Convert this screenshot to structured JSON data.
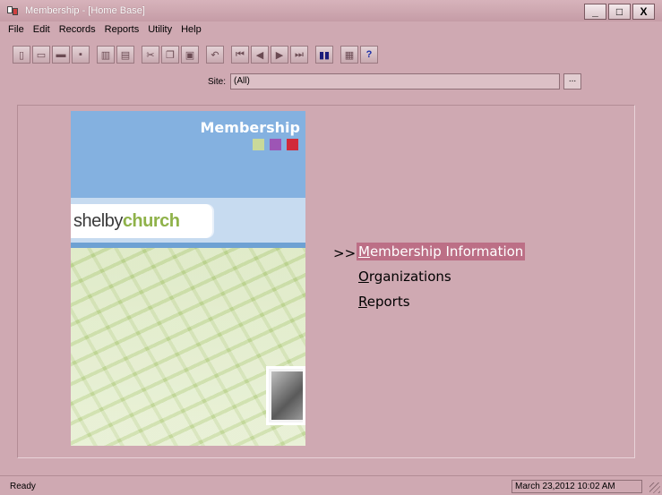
{
  "window": {
    "title": "Membership - [Home Base]",
    "controls": {
      "minimize": "_",
      "maximize": "□",
      "close": "X"
    }
  },
  "menubar": [
    "File",
    "Edit",
    "Records",
    "Reports",
    "Utility",
    "Help"
  ],
  "toolbar": {
    "icons": [
      "new-icon",
      "open-icon",
      "open-folder-icon",
      "save-icon",
      "delete-icon",
      "print-icon",
      "cut-icon",
      "copy-icon",
      "paste-icon",
      "undo-icon",
      "first-record-icon",
      "previous-record-icon",
      "next-record-icon",
      "last-record-icon",
      "chart-icon",
      "calculator-icon",
      "help-icon"
    ],
    "help_label": "?"
  },
  "site": {
    "label": "Site:",
    "value": "(All)",
    "button": "..."
  },
  "artwork": {
    "title": "Membership",
    "logo_part1": "shelby",
    "logo_part2": "church"
  },
  "nav": {
    "arrows": ">>",
    "items": [
      {
        "first": "M",
        "rest": "embership Information",
        "active": true
      },
      {
        "first": "O",
        "rest": "rganizations",
        "active": false
      },
      {
        "first": "R",
        "rest": "eports",
        "active": false
      }
    ]
  },
  "status": {
    "text": "Ready",
    "datetime": "March 23,2012 10:02 AM"
  },
  "colors": {
    "background": "#cfa9b2",
    "highlight": "#bc6f86",
    "banner_blue": "#84b1e0",
    "logo_green": "#8fb24a"
  }
}
